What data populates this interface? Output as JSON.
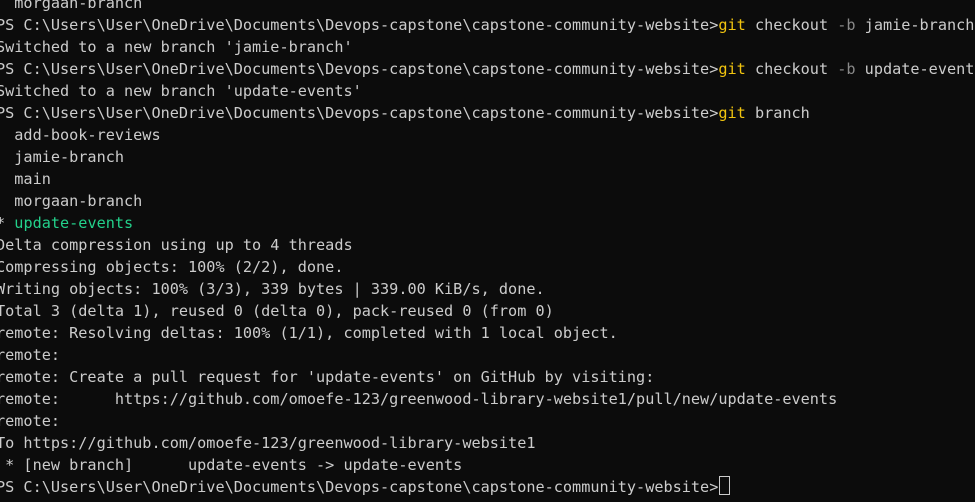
{
  "prompt": "PS C:\\Users\\User\\OneDrive\\Documents\\Devops-capstone\\capstone-community-website>",
  "lines": [
    {
      "type": "text",
      "text": "  morgaan-branch"
    },
    {
      "type": "command",
      "cmd": "git",
      "args": " checkout ",
      "flag": "-b",
      "rest": " jamie-branch"
    },
    {
      "type": "text",
      "text": "Switched to a new branch 'jamie-branch'"
    },
    {
      "type": "command",
      "cmd": "git",
      "args": " checkout ",
      "flag": "-b",
      "rest": " update-events"
    },
    {
      "type": "text",
      "text": "Switched to a new branch 'update-events'"
    },
    {
      "type": "command",
      "cmd": "git",
      "args": " branch",
      "flag": "",
      "rest": ""
    },
    {
      "type": "text",
      "text": "  add-book-reviews"
    },
    {
      "type": "text",
      "text": "  jamie-branch"
    },
    {
      "type": "text",
      "text": "  main"
    },
    {
      "type": "text",
      "text": "  morgaan-branch"
    },
    {
      "type": "current",
      "marker": "* ",
      "text": "update-events"
    },
    {
      "type": "text",
      "text": "Delta compression using up to 4 threads"
    },
    {
      "type": "text",
      "text": "Compressing objects: 100% (2/2), done."
    },
    {
      "type": "text",
      "text": "Writing objects: 100% (3/3), 339 bytes | 339.00 KiB/s, done."
    },
    {
      "type": "text",
      "text": "Total 3 (delta 1), reused 0 (delta 0), pack-reused 0 (from 0)"
    },
    {
      "type": "text",
      "text": "remote: Resolving deltas: 100% (1/1), completed with 1 local object."
    },
    {
      "type": "text",
      "text": "remote:"
    },
    {
      "type": "text",
      "text": "remote: Create a pull request for 'update-events' on GitHub by visiting:"
    },
    {
      "type": "text",
      "text": "remote:      https://github.com/omoefe-123/greenwood-library-website1/pull/new/update-events"
    },
    {
      "type": "text",
      "text": "remote:"
    },
    {
      "type": "text",
      "text": "To https://github.com/omoefe-123/greenwood-library-website1"
    },
    {
      "type": "text",
      "text": " * [new branch]      update-events -> update-events"
    },
    {
      "type": "prompt-only"
    }
  ],
  "colors": {
    "background": "#0c0c0c",
    "foreground": "#cccccc",
    "command": "#f1c40f",
    "flag": "#8a8a8a",
    "current_branch": "#23d18b"
  }
}
